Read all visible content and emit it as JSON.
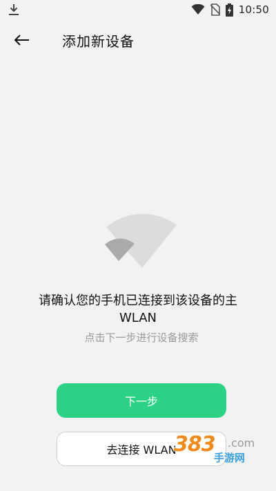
{
  "status_bar": {
    "time": "10:50",
    "icons": [
      "download-icon",
      "wifi-icon",
      "no-sim-icon",
      "battery-charging-icon"
    ]
  },
  "header": {
    "back_icon": "arrow-left-icon",
    "title": "添加新设备"
  },
  "illustration": {
    "icon": "wifi-icon"
  },
  "content": {
    "confirm_text": "请确认您的手机已连接到该设备的主WLAN",
    "hint_text": "点击下一步进行设备搜索"
  },
  "buttons": {
    "next_label": "下一步",
    "connect_label": "去连接 WLAN"
  },
  "watermark": {
    "logo": "383",
    "dot_com": ".com",
    "sub": "手游网"
  },
  "colors": {
    "background": "#f2f2f2",
    "primary": "#2bd184",
    "hint": "#9a9a9a"
  }
}
